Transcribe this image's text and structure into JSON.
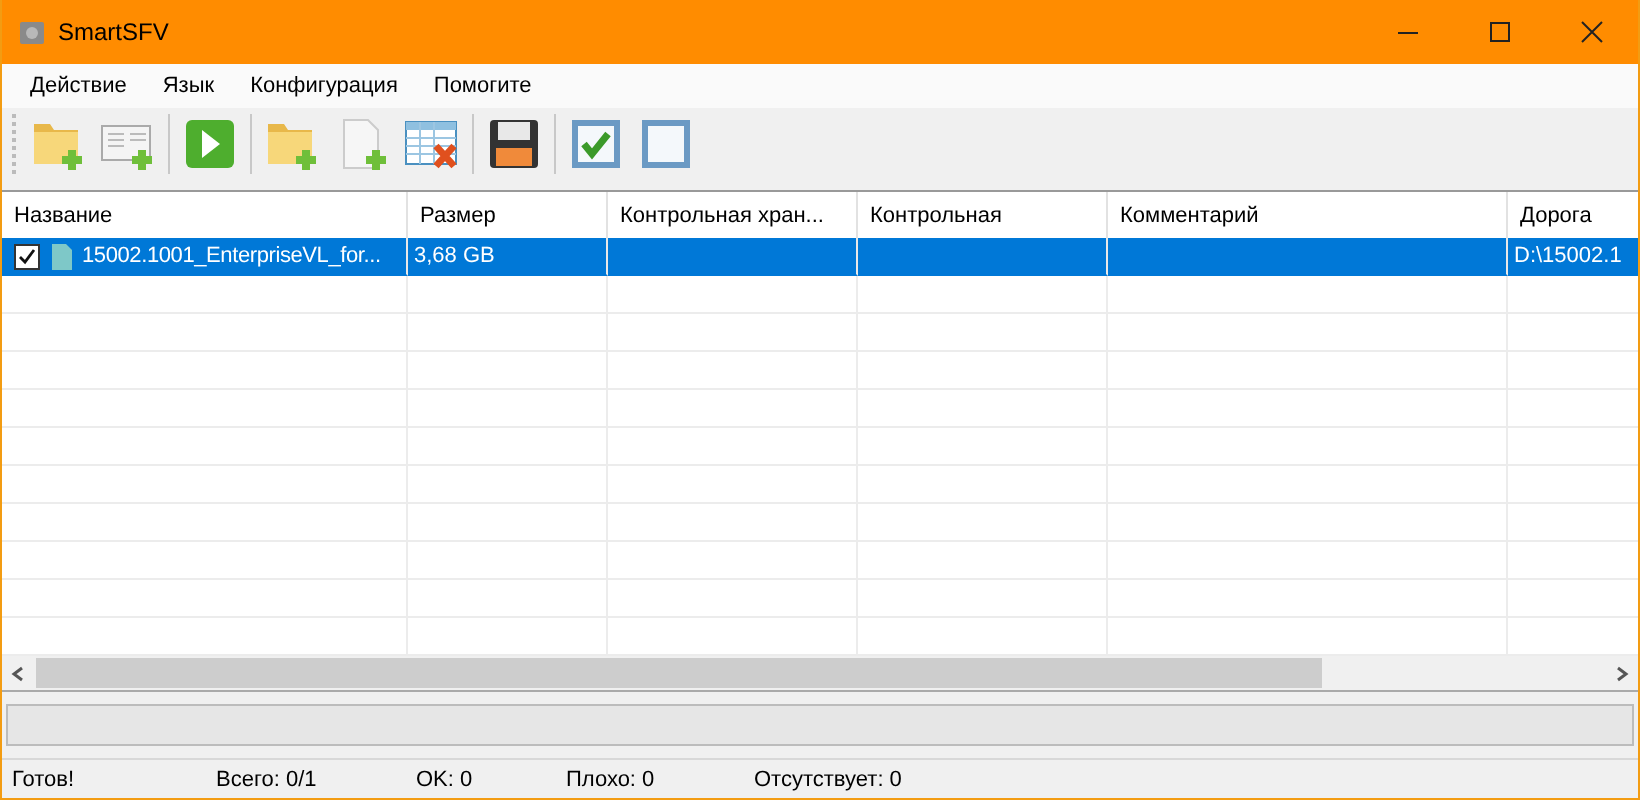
{
  "window": {
    "title": "SmartSFV"
  },
  "menu": [
    "Действие",
    "Язык",
    "Конфигурация",
    "Помогите"
  ],
  "table": {
    "columns": [
      "Название",
      "Размер",
      "Контрольная хран...",
      "Контрольная",
      "Комментарий",
      "Дорога"
    ],
    "rows": [
      {
        "checked": true,
        "selected": true,
        "cells": [
          "15002.1001_EnterpriseVL_for...",
          "3,68 GB",
          "",
          "",
          "",
          "D:\\15002.1"
        ]
      }
    ]
  },
  "progress": {
    "level": 0
  },
  "status_bar": [
    "Готов!",
    "Всего: 0/1",
    "OK: 0",
    "Плохо: 0",
    "Отсутствует: 0"
  ]
}
